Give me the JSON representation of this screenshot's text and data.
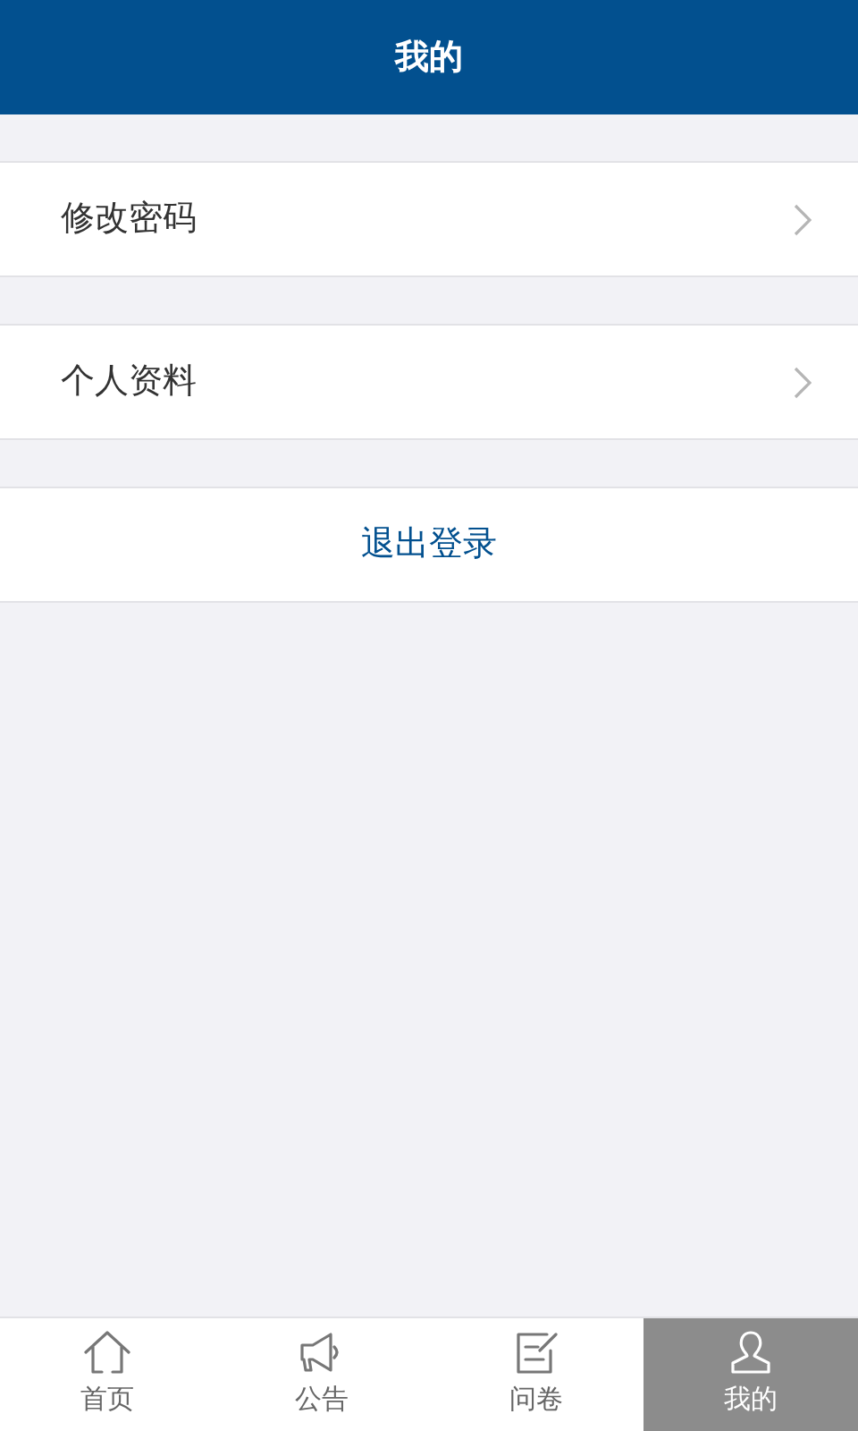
{
  "header": {
    "title": "我的"
  },
  "menu": [
    {
      "label": "修改密码"
    },
    {
      "label": "个人资料"
    }
  ],
  "logout": {
    "label": "退出登录"
  },
  "tabs": [
    {
      "label": "首页",
      "kind": "home",
      "selected": false
    },
    {
      "label": "公告",
      "kind": "announce",
      "selected": false
    },
    {
      "label": "问卷",
      "kind": "survey",
      "selected": false
    },
    {
      "label": "我的",
      "kind": "profile",
      "selected": true
    }
  ]
}
